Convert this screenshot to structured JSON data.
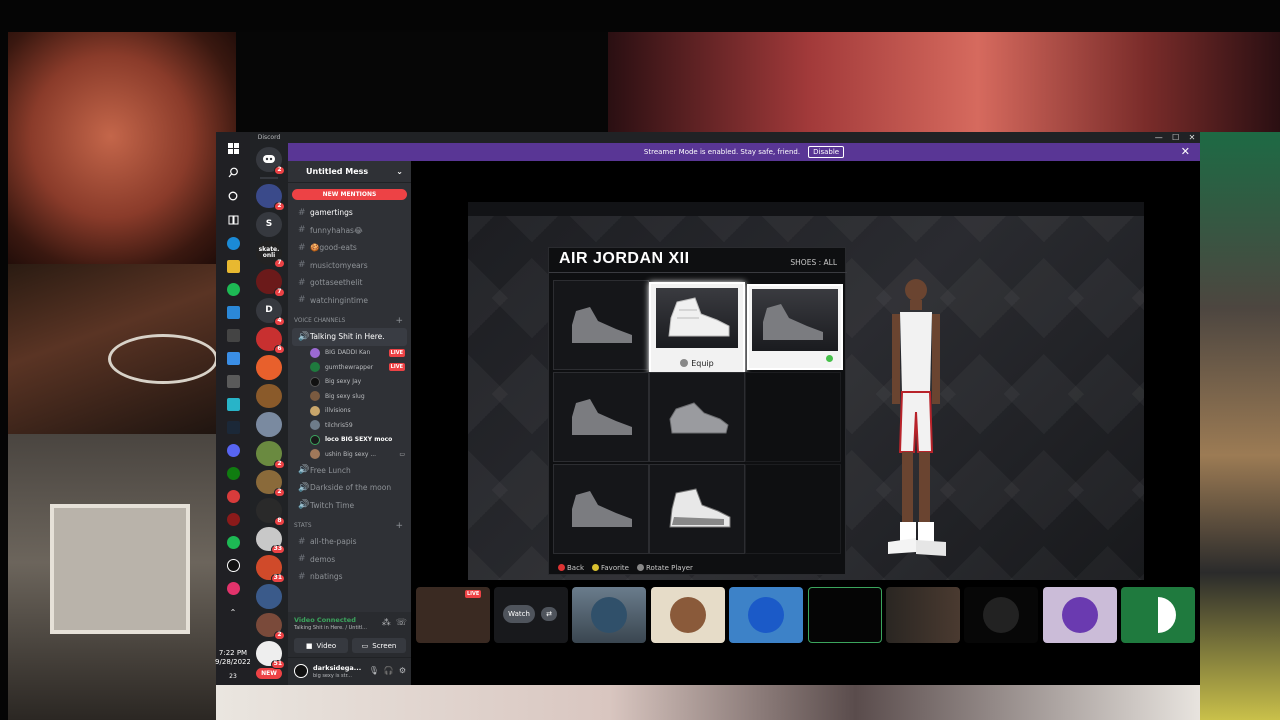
{
  "discord": {
    "brand": "Discord",
    "streamer_bar": {
      "message": "Streamer Mode is enabled. Stay safe, friend.",
      "disable_label": "Disable"
    },
    "window_controls": {
      "minimize": "—",
      "maximize": "☐",
      "close": "✕"
    },
    "guild_badges": [
      "2",
      "2",
      "7",
      "7",
      "4",
      "6",
      "2",
      "2",
      "8",
      "33",
      "31",
      "2",
      "51"
    ],
    "guild_letters": {
      "s": "S",
      "d": "D",
      "skate": "skate.",
      "skate2": "onli"
    },
    "new_badge": "NEW",
    "server_name": "Untitled Mess",
    "new_mentions": "NEW MENTIONS",
    "text_channels": [
      {
        "name": "gamertings",
        "unread": true
      },
      {
        "name": "funnyhahas😂",
        "unread": false
      },
      {
        "name": "🍪good-eats",
        "unread": false
      },
      {
        "name": "musictomyears",
        "unread": false
      },
      {
        "name": "gottaseethelit",
        "unread": false
      },
      {
        "name": "watchingintime",
        "unread": false
      }
    ],
    "voice_category": "VOICE CHANNELS",
    "active_voice_channel": "Talking Shit in Here.",
    "voice_users": [
      {
        "name": "BIG DADDI Kan",
        "live": "LIVE",
        "color": "#9b6ad2"
      },
      {
        "name": "gumthewrapper",
        "live": "LIVE",
        "color": "#1f7a3e"
      },
      {
        "name": "Big sexy Jay",
        "live": "",
        "color": "#111111"
      },
      {
        "name": "Big sexy slug",
        "live": "",
        "color": "#7a5a40"
      },
      {
        "name": "illvisions",
        "live": "",
        "color": "#c9a66b"
      },
      {
        "name": "tilchris59",
        "live": "",
        "color": "#6e7c8a"
      },
      {
        "name": "loco BIG SEXY moco",
        "live": "",
        "color": "#1a1a1a",
        "bold": true
      },
      {
        "name": "ushin Big sexy ...",
        "live": "",
        "color": "#a0785a"
      }
    ],
    "other_voice_channels": [
      "Free Lunch",
      "Darkside of the moon",
      "Twitch Time"
    ],
    "stats_category": "STATS",
    "stats_channels": [
      "all-the-papis",
      "demos",
      "nbatings"
    ],
    "voice_status": "Video Connected",
    "voice_location": "Talking Shit in Here. / Untitl...",
    "video_label": "Video",
    "screen_label": "Screen",
    "user": {
      "name": "darksidega...",
      "status": "big sexy is str..."
    },
    "stream_tiles": {
      "live": "LIVE",
      "watch": "Watch"
    }
  },
  "taskbar": {
    "time": "7:22 PM",
    "date": "9/28/2022",
    "notif_count": "23"
  },
  "game": {
    "shoe_title": "AIR JORDAN XII",
    "shoe_filter": "SHOES : ALL",
    "equip_label": "Equip",
    "controls": [
      "Back",
      "Favorite",
      "Rotate Player"
    ]
  },
  "colors": {
    "discord_purple": "#593695",
    "discord_red": "#ed4245",
    "discord_green": "#3ba55d",
    "channel_bg": "#2f3136",
    "guild_bg": "#202225"
  }
}
